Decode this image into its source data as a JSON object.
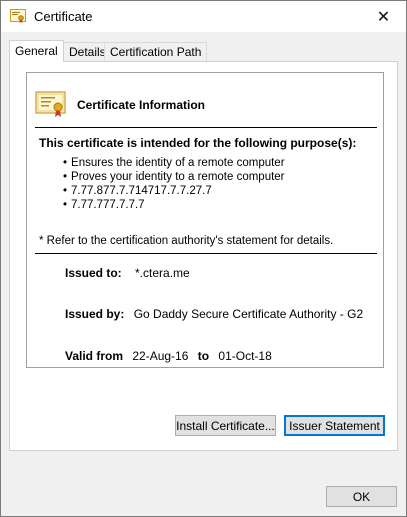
{
  "window": {
    "title": "Certificate",
    "close_glyph": "✕"
  },
  "tabs": [
    {
      "label": "General",
      "active": true
    },
    {
      "label": "Details",
      "active": false
    },
    {
      "label": "Certification Path",
      "active": false
    }
  ],
  "general": {
    "info_title": "Certificate Information",
    "purpose_heading": "This certificate is intended for the following purpose(s):",
    "purposes": [
      "Ensures the identity of a remote computer",
      "Proves your identity to a remote computer",
      "7.77.877.7.714717.7.7.27.7",
      "7.77.777.7.7.7"
    ],
    "refer_note": "* Refer to the certification authority's statement for details.",
    "issued_to_label": "Issued to:",
    "issued_to_value": "*.ctera.me",
    "issued_by_label": "Issued by:",
    "issued_by_value": "Go Daddy Secure Certificate Authority - G2",
    "valid_from_label": "Valid from",
    "valid_from_value": "22-Aug-16",
    "valid_to_label": "to",
    "valid_to_value": "01-Oct-18"
  },
  "buttons": {
    "install": "Install Certificate...",
    "issuer_statement": "Issuer Statement",
    "ok": "OK"
  },
  "icons": {
    "title": "certificate-icon",
    "info": "certificate-icon",
    "close": "close-icon"
  },
  "colors": {
    "accent": "#0078d7",
    "window_bg": "#f0f0f0"
  }
}
